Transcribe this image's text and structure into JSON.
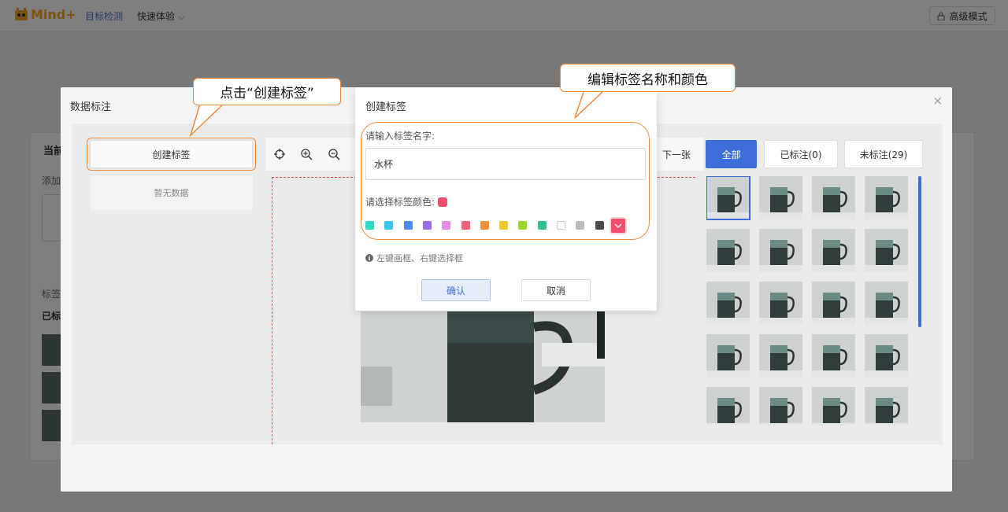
{
  "app": {
    "brand": "Mind+",
    "nav_active": "目标检测",
    "nav_item": "快速体验",
    "advanced_mode": "高级模式"
  },
  "background": {
    "title_partial": "当前",
    "add_partial": "添加",
    "tag_partial": "标签",
    "done_partial": "已标"
  },
  "main_dialog": {
    "title": "数据标注",
    "close": "×",
    "create_label_button": "创建标签",
    "no_data": "暂无数据",
    "next_button": "下一张",
    "filters": {
      "all": "全部",
      "labeled": "已标注(0)",
      "unlabeled": "未标注(29)"
    }
  },
  "label_dialog": {
    "title": "创建标签",
    "name_prompt": "请输入标签名字:",
    "name_value": "水杯",
    "color_prompt": "请选择标签颜色:",
    "selected_color": "#f0506e",
    "swatches": [
      "#2ed8c3",
      "#36c6f0",
      "#4a8cf0",
      "#9b6cf0",
      "#e889e8",
      "#f0607a",
      "#f0903a",
      "#f0c832",
      "#9ad62a",
      "#30c090",
      "#ffffff",
      "#bbbbbb",
      "#4a4a4a"
    ],
    "hint": "左键画框、右键选择框",
    "confirm": "确认",
    "cancel": "取消"
  },
  "annotations": {
    "click_create": "点击“创建标签”",
    "edit_name_color": "编辑标签名称和颜色"
  },
  "colors": {
    "accent": "#3d6fd8",
    "highlight": "#ee8a3a"
  }
}
